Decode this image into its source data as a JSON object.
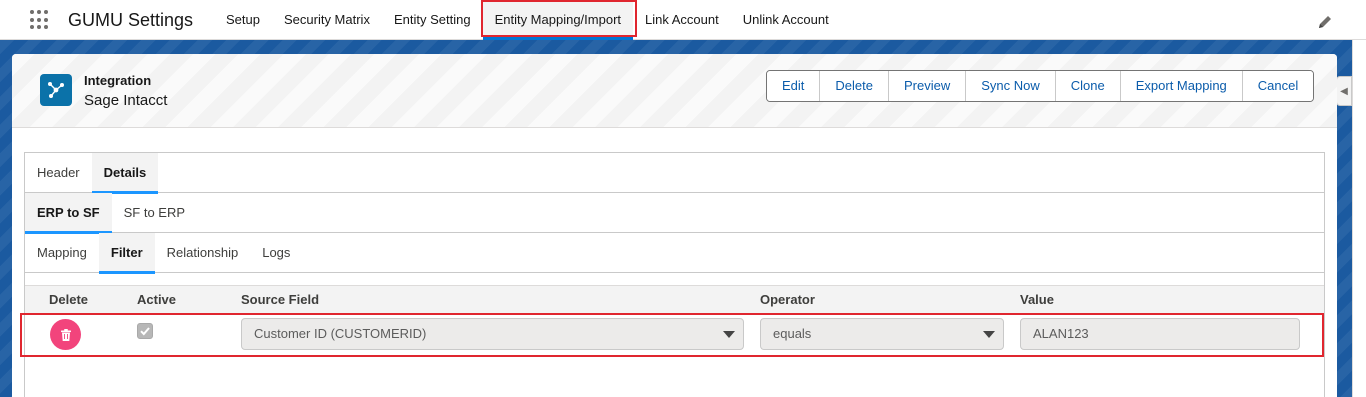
{
  "app": {
    "name": "GUMU Settings"
  },
  "nav": {
    "items": [
      {
        "label": "Setup"
      },
      {
        "label": "Security Matrix"
      },
      {
        "label": "Entity Setting"
      },
      {
        "label": "Entity Mapping/Import",
        "active": true
      },
      {
        "label": "Link Account"
      },
      {
        "label": "Unlink Account"
      }
    ]
  },
  "record": {
    "type_label": "Integration",
    "name": "Sage Intacct",
    "icon": "integration-icon"
  },
  "actions": {
    "edit": "Edit",
    "delete": "Delete",
    "preview": "Preview",
    "sync_now": "Sync Now",
    "clone": "Clone",
    "export_mapping": "Export Mapping",
    "cancel": "Cancel"
  },
  "tabs": {
    "level1": [
      "Header",
      "Details"
    ],
    "level1_active": "Details",
    "level2": [
      "ERP to SF",
      "SF to ERP"
    ],
    "level2_active": "ERP to SF",
    "level3": [
      "Mapping",
      "Filter",
      "Relationship",
      "Logs"
    ],
    "level3_active": "Filter"
  },
  "filter_table": {
    "headers": {
      "delete": "Delete",
      "active": "Active",
      "source_field": "Source Field",
      "operator": "Operator",
      "value": "Value"
    },
    "rows": [
      {
        "active": true,
        "source_field": "Customer ID (CUSTOMERID)",
        "operator": "equals",
        "value": "ALAN123"
      }
    ]
  },
  "colors": {
    "brand_blue": "#1b5aa0",
    "link_blue": "#0b5cab",
    "highlight_red": "#e0262f",
    "delete_pink": "#f2447c"
  }
}
